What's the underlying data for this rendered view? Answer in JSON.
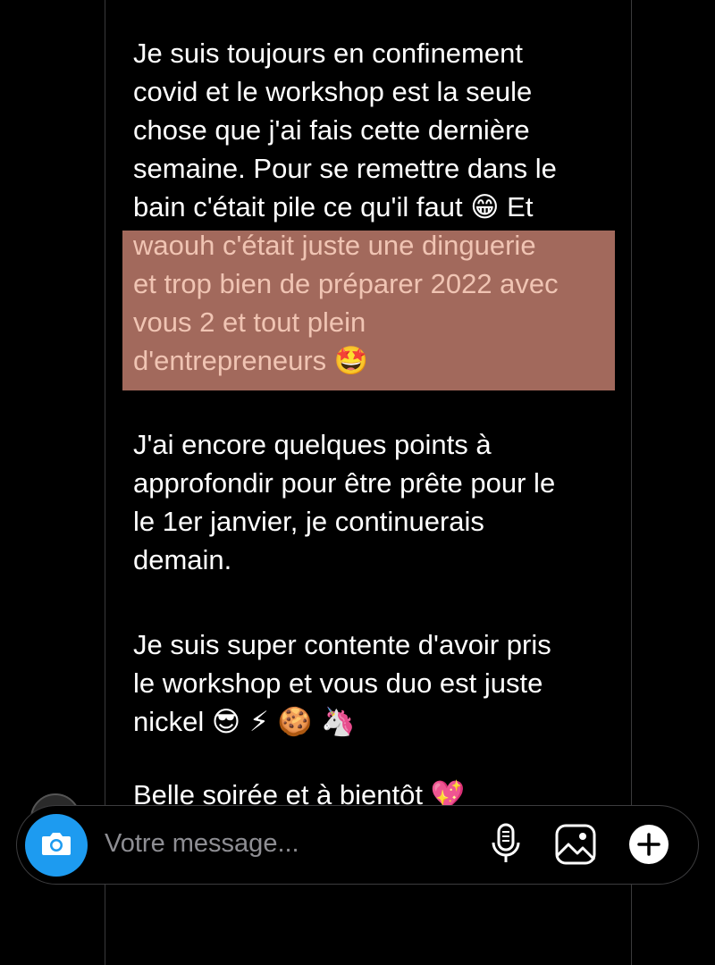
{
  "message": {
    "para1_line1": "Je suis toujours en confinement",
    "para1_line2": "covid et le workshop est la seule",
    "para1_line3": "chose que j'ai fais cette dernière",
    "para1_line4": "semaine. Pour se remettre dans le",
    "para1_line5a": "bain c'était pile ce qu'il faut",
    "para1_emoji1": "😁",
    "para1_line5b": "Et",
    "hl_line1": "waouh c'était juste une dinguerie",
    "hl_line2": "et trop bien de préparer 2022 avec",
    "hl_line3": "vous 2 et tout plein",
    "hl_line4": "d'entrepreneurs",
    "hl_emoji": "🤩",
    "para2_line1": "J'ai encore quelques points à",
    "para2_line2": "approfondir pour être prête pour le",
    "para2_line3": "le 1er janvier, je continuerais",
    "para2_line4": "demain.",
    "para3_line1": "Je suis super contente d'avoir pris",
    "para3_line2": "le workshop et vous duo est juste",
    "para3_line3": "nickel",
    "para3_emojis": "😎 ⚡ 🍪 🦄",
    "para4_line1": "Belle soirée et à bientôt",
    "para4_emoji": "💖"
  },
  "composer": {
    "placeholder": "Votre message...",
    "icons": [
      "camera-icon",
      "microphone-icon",
      "gallery-icon",
      "plus-icon"
    ],
    "accent_color": "#1d9bf0"
  },
  "colors": {
    "background": "#000000",
    "highlight": "#a2695c",
    "highlight_text": "#f0c4b3"
  }
}
